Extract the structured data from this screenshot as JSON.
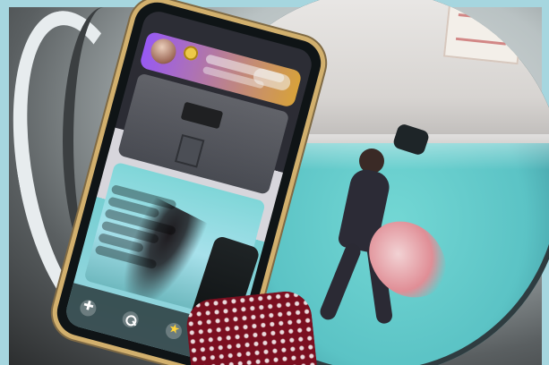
{
  "image": {
    "kind": "photo",
    "elements": {
      "phone_screen": {
        "status_time": "",
        "status_icons": ""
      }
    }
  }
}
